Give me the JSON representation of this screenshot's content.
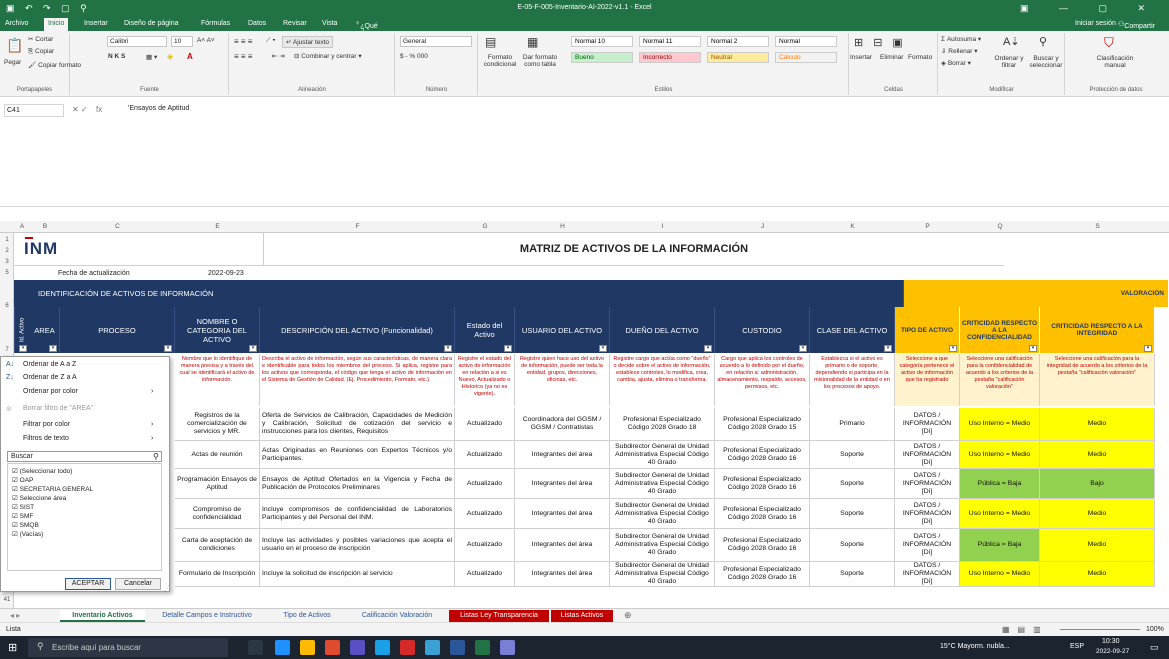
{
  "window": {
    "title": "E-05-F-005-Inventario-AI-2022-v1.1 - Excel"
  },
  "tabs": [
    "Archivo",
    "Inicio",
    "Insertar",
    "Diseño de página",
    "Fórmulas",
    "Datos",
    "Revisar",
    "Vista",
    "¿Qué desea hacer?"
  ],
  "account": {
    "signin": "Iniciar sesión",
    "share": "Compartir"
  },
  "ribbon": {
    "paste": "Pegar",
    "cut": "Cortar",
    "copy": "Copiar",
    "copy_format": "Copiar formato",
    "font_name": "Calibri",
    "font_size": "10",
    "bold_italic": "N K S",
    "wrap": "Ajustar texto",
    "merge": "Combinar y centrar",
    "number_format": "General",
    "num_symbols": "$ - % 000",
    "cond_format": "Formato condicional",
    "as_table": "Dar formato como tabla",
    "styles": [
      {
        "label": "Normal 10",
        "bg": "#ffffff",
        "fg": "#000"
      },
      {
        "label": "Normal 11",
        "bg": "#ffffff",
        "fg": "#000"
      },
      {
        "label": "Normal 2",
        "bg": "#ffffff",
        "fg": "#000"
      },
      {
        "label": "Normal",
        "bg": "#ffffff",
        "fg": "#000"
      },
      {
        "label": "Bueno",
        "bg": "#c6efce",
        "fg": "#006100"
      },
      {
        "label": "Incorrecto",
        "bg": "#ffc7ce",
        "fg": "#9c0006"
      },
      {
        "label": "Neutral",
        "bg": "#ffeb9c",
        "fg": "#9c5700"
      },
      {
        "label": "Cálculo",
        "bg": "#f2f2f2",
        "fg": "#fa7d00"
      }
    ],
    "insert": "Insertar",
    "delete": "Eliminar",
    "format": "Formato",
    "autosum": "Autosuma",
    "fill": "Rellenar",
    "clear": "Borrar",
    "sort": "Ordenar y filtrar",
    "find": "Buscar y seleccionar",
    "classify": "Clasificación manual",
    "groups": {
      "clipboard": "Portapapeles",
      "font": "Fuente",
      "alignment": "Alineación",
      "number": "Número",
      "styles": "Estilos",
      "cells": "Celdas",
      "modify": "Modificar",
      "protection": "Protección de datos"
    }
  },
  "formula_bar": {
    "cell_ref": "C41",
    "fx": "fx",
    "value": "'Ensayos de Aptitud"
  },
  "columns": [
    "A",
    "B",
    "C",
    "E",
    "F",
    "G",
    "H",
    "I",
    "J",
    "K",
    "P",
    "Q",
    "S"
  ],
  "rows": [
    "1",
    "2",
    "3",
    "5",
    "6",
    "7",
    "41"
  ],
  "sheet": {
    "matrix_title": "MATRIZ DE ACTIVOS DE LA INFORMACIÓN",
    "logo": "INM",
    "update_label": "Fecha de actualización",
    "update_date": "2022-09-23",
    "section_ident": "IDENTIFICACIÓN DE ACTIVOS DE INFORMACIÓN",
    "section_val": "VALORACIÓN",
    "headers": [
      "Id. Activo",
      "AREA",
      "PROCESO",
      "NOMBRE O CATEGORIA DEL ACTIVO",
      "DESCRIPCIÓN DEL ACTIVO (Funcionalidad)",
      "Estado del Activo",
      "USUARIO DEL ACTIVO",
      "DUEÑO DEL ACTIVO",
      "CUSTODIO",
      "CLASE DEL ACTIVO",
      "TIPO DE ACTIVO",
      "CRITICIDAD RESPECTO A LA CONFIDENCIALIDAD",
      "CRITICIDAD RESPECTO A LA INTEGRIDAD"
    ],
    "hints": [
      "Nombre que lo identifique de manera precisa y a través del cual se identificará el activo de información.",
      "Describa el activo de información, según sus características, de manera clara e identificable para todos los miembros del proceso. Si aplica, registre para los activos que corresponda, el código que tenga el activo de información en el Sistema de Gestión de Calidad. (Ej. Procedimiento, Formato, etc.)",
      "Registre el estado del activo de información en relación a si es Nuevo, Actualizado o Historico (ya no es vigente).",
      "Registre quien hace uso del activo de información, puede ser toda la entidad, grupos, direcciones, oficinas, etc.",
      "Registre cargo que actúa como \"dueño\" o decide sobre el activo de información, establece controles, lo modifica, crea, cambia, ajusta, elimina o transforma.",
      "Cargo que aplica los controles de acuerdo a lo definido por el dueño, en relación a: administración, almacenamiento, respaldo, accesos, permisos, etc.",
      "Establezca si el activo es primario o de soporte, dependiendo si participa en la misionalidad de la entidad o en los procesos de apoyo.",
      "Seleccione a que categoría pertenece el activo de información que ha registrado",
      "Seleccione una calificación para la confidencialidad de acuerdo a los criterios de la pestaña \"calificación valoración\"",
      "Seleccione una calificación para la integridad de acuerdo a los criterios de la pestaña \"calificación valoración\""
    ],
    "data_rows": [
      {
        "name": "Registros de la comercialización de servicios y MR.",
        "desc": "Oferta de Servicios de Calibración, Capacidades de Medición y Calibración, Solicitud de cotización del servicio e instrucciones para los clientes, Requisitos",
        "estado": "Actualizado",
        "usuario": "Coordinadora del GGSM / GGSM / Contratistas",
        "dueno": "Profesional Especializado Código 2028 Grado 18",
        "custodio": "Profesional Especializado Código 2028 Grado 15",
        "clase": "Primario",
        "tipo": "DATOS / INFORMACIÓN [Di]",
        "conf": "Uso Interno = Medio",
        "conf_color": "#ffff00",
        "integ": "Medio",
        "integ_color": "#ffff00"
      },
      {
        "name": "Actas de reunión",
        "desc": "Actas Originadas en Reuniones con Expertos Técnicos y/o Participantes.",
        "estado": "Actualizado",
        "usuario": "Integrantes del área",
        "dueno": "Subdirector General de Unidad Administrativa Especial Código 40 Grado",
        "custodio": "Profesional Especializado Código 2028 Grado 16",
        "clase": "Soporte",
        "tipo": "DATOS / INFORMACIÓN [Di]",
        "conf": "Uso Interno = Medio",
        "conf_color": "#ffff00",
        "integ": "Medio",
        "integ_color": "#ffff00"
      },
      {
        "name": "Programación Ensayos de Aptitud",
        "desc": "Ensayos de Aptitud Ofertados en la Vigencia y Fecha de Publicación de Protocolos Preliminares",
        "estado": "Actualizado",
        "usuario": "Integrantes del área",
        "dueno": "Subdirector General de Unidad Administrativa Especial Código 40 Grado",
        "custodio": "Profesional Especializado Código 2028 Grado 16",
        "clase": "Soporte",
        "tipo": "DATOS / INFORMACIÓN [Di]",
        "conf": "Pública = Baja",
        "conf_color": "#92d050",
        "integ": "Bajo",
        "integ_color": "#92d050"
      },
      {
        "name": "Compromiso de confidencialidad",
        "desc": "Incluye compromisos de confidencialidad de Laboratorios Participantes y del Personal del INM.",
        "estado": "Actualizado",
        "usuario": "Integrantes del área",
        "dueno": "Subdirector General de Unidad Administrativa Especial Código 40 Grado",
        "custodio": "Profesional Especializado Código 2028 Grado 16",
        "clase": "Soporte",
        "tipo": "DATOS / INFORMACIÓN [Di]",
        "conf": "Uso Interno = Medio",
        "conf_color": "#ffff00",
        "integ": "Medio",
        "integ_color": "#ffff00"
      },
      {
        "name": "Carta de aceptación de condiciones",
        "desc": "Incluye las actividades y posibles variaciones que acepta el usuario en el proceso de inscripción",
        "estado": "Actualizado",
        "usuario": "Integrantes del área",
        "dueno": "Subdirector General de Unidad Administrativa Especial Código 40 Grado",
        "custodio": "Profesional Especializado Código 2028 Grado 16",
        "clase": "Soporte",
        "tipo": "DATOS / INFORMACIÓN [Di]",
        "conf": "Pública = Baja",
        "conf_color": "#92d050",
        "integ": "Medio",
        "integ_color": "#ffff00"
      },
      {
        "name": "Formulario de Inscripción",
        "desc": "Incluye la solicitud de inscripción al servicio",
        "estado": "Actualizado",
        "usuario": "Integrantes del área",
        "dueno": "Subdirector General de Unidad Administrativa Especial Código 40 Grado",
        "custodio": "Profesional Especializado Código 2028 Grado 16",
        "clase": "Soporte",
        "tipo": "DATOS / INFORMACIÓN [Di]",
        "conf": "Uso Interno = Medio",
        "conf_color": "#ffff00",
        "integ": "Medio",
        "integ_color": "#ffff00"
      }
    ]
  },
  "filter_menu": {
    "items": [
      "Ordenar de A a Z",
      "Ordenar de Z a A",
      "Ordenar por color",
      "Borrar filtro de \"AREA\"",
      "Filtrar por color",
      "Filtros de texto"
    ],
    "search_placeholder": "Buscar",
    "checks": [
      "(Seleccionar todo)",
      "OAP",
      "SECRETARIA GENERAL",
      "Seleccione área",
      "SIST",
      "SMF",
      "SMQB",
      "(Vacías)"
    ],
    "ok": "ACEPTAR",
    "cancel": "Cancelar"
  },
  "sheet_tabs": [
    {
      "label": "Inventario Activos",
      "active": true,
      "color": ""
    },
    {
      "label": "Detalle Campos e Instructivo",
      "active": false,
      "color": ""
    },
    {
      "label": "Tipo de Activos",
      "active": false,
      "color": ""
    },
    {
      "label": "Calificación Valoración",
      "active": false,
      "color": ""
    },
    {
      "label": "Listas Ley Transparencia",
      "active": false,
      "color": "#c00000"
    },
    {
      "label": "Listas Activos",
      "active": false,
      "color": "#c00000"
    }
  ],
  "status": {
    "ready": "Lista",
    "zoom": "100%"
  },
  "taskbar": {
    "search": "Escribe aquí para buscar",
    "weather": "15°C  Mayorm. nubla...",
    "lang": "ESP",
    "time": "10:30",
    "date": "2022-09-27"
  }
}
